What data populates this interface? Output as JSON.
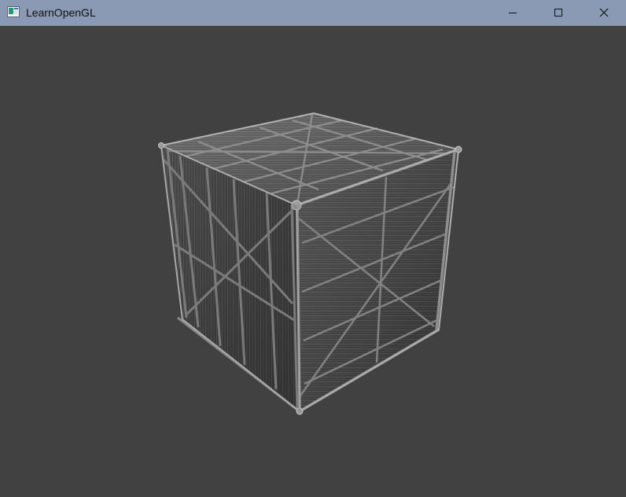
{
  "window": {
    "title": "LearnOpenGL"
  },
  "icons": {
    "app": "app-window-icon",
    "minimize": "minimize-icon",
    "maximize": "maximize-icon",
    "close": "close-icon"
  },
  "colors": {
    "titlebar": "#8a9ab4",
    "viewport": "#414141"
  }
}
